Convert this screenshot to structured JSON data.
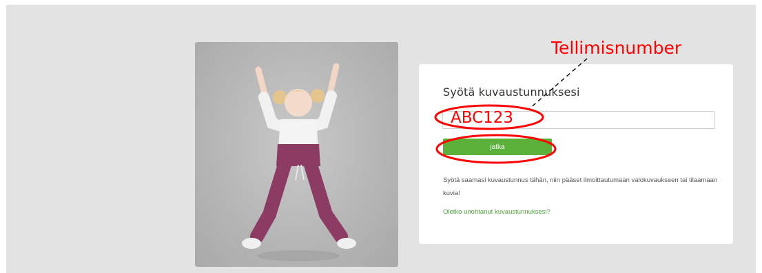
{
  "card": {
    "title": "Syötä kuvaustunnuksesi",
    "input_value": "",
    "input_placeholder": "",
    "continue_label": "jatka",
    "help_text": "Syötä saamasi kuvaustunnus tähän, niin pääset ilmoittautumaan valokuvaukseen tai tilaamaan kuvia!",
    "forgot_link": "Oletko unohtanut kuvaustunnuksesi?"
  },
  "annotations": {
    "label": "Tellimisnumber",
    "example_value": "ABC123",
    "color": "#ff0000"
  },
  "colors": {
    "accent_green": "#5bb03a",
    "link_green": "#4aa336",
    "page_gray": "#e3e3e3"
  },
  "photo": {
    "icon": "child-jumping-photo"
  }
}
